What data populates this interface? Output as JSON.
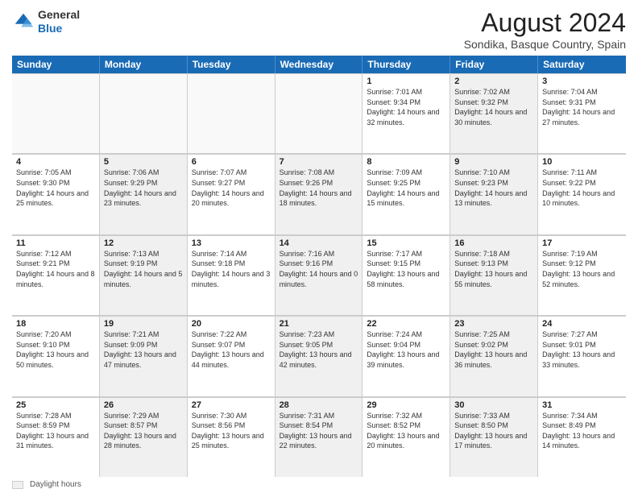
{
  "header": {
    "logo_line1": "General",
    "logo_line2": "Blue",
    "month_title": "August 2024",
    "location": "Sondika, Basque Country, Spain"
  },
  "days_of_week": [
    "Sunday",
    "Monday",
    "Tuesday",
    "Wednesday",
    "Thursday",
    "Friday",
    "Saturday"
  ],
  "legend": {
    "label": "Daylight hours"
  },
  "weeks": [
    [
      {
        "day": "",
        "info": "",
        "shaded": false,
        "empty": true
      },
      {
        "day": "",
        "info": "",
        "shaded": false,
        "empty": true
      },
      {
        "day": "",
        "info": "",
        "shaded": false,
        "empty": true
      },
      {
        "day": "",
        "info": "",
        "shaded": false,
        "empty": true
      },
      {
        "day": "1",
        "info": "Sunrise: 7:01 AM\nSunset: 9:34 PM\nDaylight: 14 hours\nand 32 minutes.",
        "shaded": false,
        "empty": false
      },
      {
        "day": "2",
        "info": "Sunrise: 7:02 AM\nSunset: 9:32 PM\nDaylight: 14 hours\nand 30 minutes.",
        "shaded": true,
        "empty": false
      },
      {
        "day": "3",
        "info": "Sunrise: 7:04 AM\nSunset: 9:31 PM\nDaylight: 14 hours\nand 27 minutes.",
        "shaded": false,
        "empty": false
      }
    ],
    [
      {
        "day": "4",
        "info": "Sunrise: 7:05 AM\nSunset: 9:30 PM\nDaylight: 14 hours\nand 25 minutes.",
        "shaded": false,
        "empty": false
      },
      {
        "day": "5",
        "info": "Sunrise: 7:06 AM\nSunset: 9:29 PM\nDaylight: 14 hours\nand 23 minutes.",
        "shaded": true,
        "empty": false
      },
      {
        "day": "6",
        "info": "Sunrise: 7:07 AM\nSunset: 9:27 PM\nDaylight: 14 hours\nand 20 minutes.",
        "shaded": false,
        "empty": false
      },
      {
        "day": "7",
        "info": "Sunrise: 7:08 AM\nSunset: 9:26 PM\nDaylight: 14 hours\nand 18 minutes.",
        "shaded": true,
        "empty": false
      },
      {
        "day": "8",
        "info": "Sunrise: 7:09 AM\nSunset: 9:25 PM\nDaylight: 14 hours\nand 15 minutes.",
        "shaded": false,
        "empty": false
      },
      {
        "day": "9",
        "info": "Sunrise: 7:10 AM\nSunset: 9:23 PM\nDaylight: 14 hours\nand 13 minutes.",
        "shaded": true,
        "empty": false
      },
      {
        "day": "10",
        "info": "Sunrise: 7:11 AM\nSunset: 9:22 PM\nDaylight: 14 hours\nand 10 minutes.",
        "shaded": false,
        "empty": false
      }
    ],
    [
      {
        "day": "11",
        "info": "Sunrise: 7:12 AM\nSunset: 9:21 PM\nDaylight: 14 hours\nand 8 minutes.",
        "shaded": false,
        "empty": false
      },
      {
        "day": "12",
        "info": "Sunrise: 7:13 AM\nSunset: 9:19 PM\nDaylight: 14 hours\nand 5 minutes.",
        "shaded": true,
        "empty": false
      },
      {
        "day": "13",
        "info": "Sunrise: 7:14 AM\nSunset: 9:18 PM\nDaylight: 14 hours\nand 3 minutes.",
        "shaded": false,
        "empty": false
      },
      {
        "day": "14",
        "info": "Sunrise: 7:16 AM\nSunset: 9:16 PM\nDaylight: 14 hours\nand 0 minutes.",
        "shaded": true,
        "empty": false
      },
      {
        "day": "15",
        "info": "Sunrise: 7:17 AM\nSunset: 9:15 PM\nDaylight: 13 hours\nand 58 minutes.",
        "shaded": false,
        "empty": false
      },
      {
        "day": "16",
        "info": "Sunrise: 7:18 AM\nSunset: 9:13 PM\nDaylight: 13 hours\nand 55 minutes.",
        "shaded": true,
        "empty": false
      },
      {
        "day": "17",
        "info": "Sunrise: 7:19 AM\nSunset: 9:12 PM\nDaylight: 13 hours\nand 52 minutes.",
        "shaded": false,
        "empty": false
      }
    ],
    [
      {
        "day": "18",
        "info": "Sunrise: 7:20 AM\nSunset: 9:10 PM\nDaylight: 13 hours\nand 50 minutes.",
        "shaded": false,
        "empty": false
      },
      {
        "day": "19",
        "info": "Sunrise: 7:21 AM\nSunset: 9:09 PM\nDaylight: 13 hours\nand 47 minutes.",
        "shaded": true,
        "empty": false
      },
      {
        "day": "20",
        "info": "Sunrise: 7:22 AM\nSunset: 9:07 PM\nDaylight: 13 hours\nand 44 minutes.",
        "shaded": false,
        "empty": false
      },
      {
        "day": "21",
        "info": "Sunrise: 7:23 AM\nSunset: 9:05 PM\nDaylight: 13 hours\nand 42 minutes.",
        "shaded": true,
        "empty": false
      },
      {
        "day": "22",
        "info": "Sunrise: 7:24 AM\nSunset: 9:04 PM\nDaylight: 13 hours\nand 39 minutes.",
        "shaded": false,
        "empty": false
      },
      {
        "day": "23",
        "info": "Sunrise: 7:25 AM\nSunset: 9:02 PM\nDaylight: 13 hours\nand 36 minutes.",
        "shaded": true,
        "empty": false
      },
      {
        "day": "24",
        "info": "Sunrise: 7:27 AM\nSunset: 9:01 PM\nDaylight: 13 hours\nand 33 minutes.",
        "shaded": false,
        "empty": false
      }
    ],
    [
      {
        "day": "25",
        "info": "Sunrise: 7:28 AM\nSunset: 8:59 PM\nDaylight: 13 hours\nand 31 minutes.",
        "shaded": false,
        "empty": false
      },
      {
        "day": "26",
        "info": "Sunrise: 7:29 AM\nSunset: 8:57 PM\nDaylight: 13 hours\nand 28 minutes.",
        "shaded": true,
        "empty": false
      },
      {
        "day": "27",
        "info": "Sunrise: 7:30 AM\nSunset: 8:56 PM\nDaylight: 13 hours\nand 25 minutes.",
        "shaded": false,
        "empty": false
      },
      {
        "day": "28",
        "info": "Sunrise: 7:31 AM\nSunset: 8:54 PM\nDaylight: 13 hours\nand 22 minutes.",
        "shaded": true,
        "empty": false
      },
      {
        "day": "29",
        "info": "Sunrise: 7:32 AM\nSunset: 8:52 PM\nDaylight: 13 hours\nand 20 minutes.",
        "shaded": false,
        "empty": false
      },
      {
        "day": "30",
        "info": "Sunrise: 7:33 AM\nSunset: 8:50 PM\nDaylight: 13 hours\nand 17 minutes.",
        "shaded": true,
        "empty": false
      },
      {
        "day": "31",
        "info": "Sunrise: 7:34 AM\nSunset: 8:49 PM\nDaylight: 13 hours\nand 14 minutes.",
        "shaded": false,
        "empty": false
      }
    ]
  ]
}
